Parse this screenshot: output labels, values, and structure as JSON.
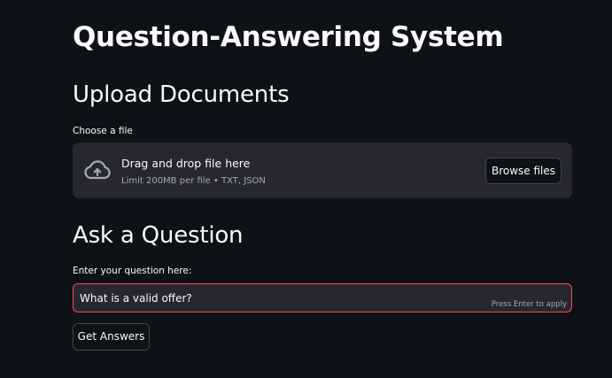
{
  "page": {
    "title": "Question-Answering System"
  },
  "upload": {
    "heading": "Upload Documents",
    "label": "Choose a file",
    "dropzone_text": "Drag and drop file here",
    "limit_text": "Limit 200MB per file • TXT, JSON",
    "browse_label": "Browse files",
    "icon": "cloud-upload-icon"
  },
  "ask": {
    "heading": "Ask a Question",
    "label": "Enter your question here:",
    "input_value": "What is a valid offer?",
    "hint": "Press Enter to apply",
    "submit_label": "Get Answers"
  },
  "colors": {
    "background": "#0e1117",
    "surface": "#262730",
    "focus_border": "#ff4b4b",
    "text": "#fafafa",
    "muted_text": "#a3a8b8"
  }
}
